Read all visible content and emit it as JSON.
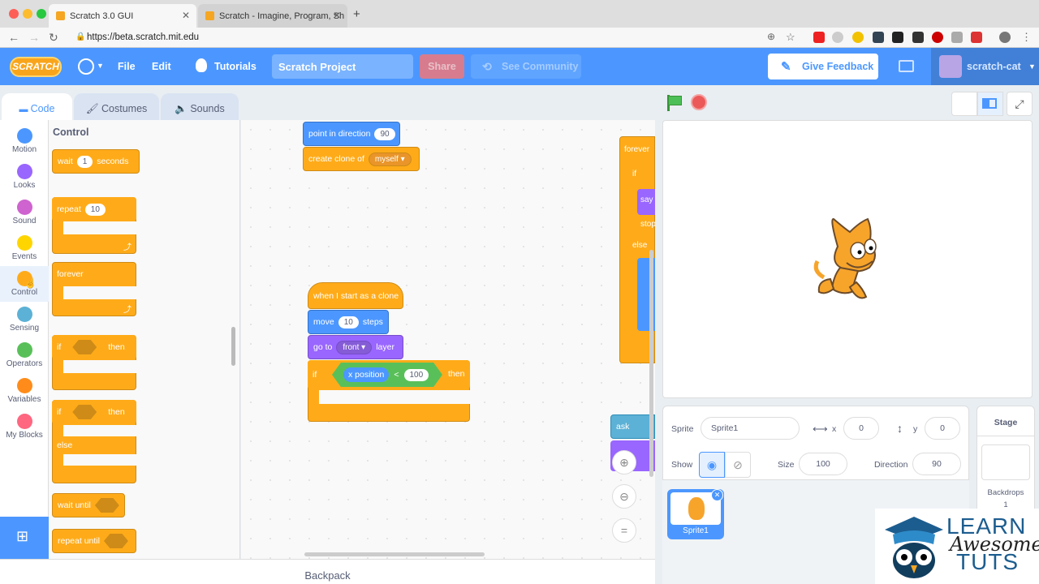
{
  "browser": {
    "tabs": [
      {
        "label": "Scratch 3.0 GUI"
      },
      {
        "label": "Scratch - Imagine, Program, Sh"
      }
    ],
    "url": "https://beta.scratch.mit.edu"
  },
  "menu": {
    "logo": "SCRATCH",
    "file": "File",
    "edit": "Edit",
    "tutorials": "Tutorials",
    "project_title": "Scratch Project",
    "share": "Share",
    "see_community": "See Community",
    "give_feedback": "Give Feedback",
    "username": "scratch-cat"
  },
  "editor_tabs": {
    "code": "Code",
    "costumes": "Costumes",
    "sounds": "Sounds"
  },
  "categories": [
    {
      "label": "Motion",
      "color": "#4c97ff"
    },
    {
      "label": "Looks",
      "color": "#9966ff"
    },
    {
      "label": "Sound",
      "color": "#cf63cf"
    },
    {
      "label": "Events",
      "color": "#ffd500"
    },
    {
      "label": "Control",
      "color": "#ffab19"
    },
    {
      "label": "Sensing",
      "color": "#5cb1d6"
    },
    {
      "label": "Operators",
      "color": "#59c059"
    },
    {
      "label": "Variables",
      "color": "#ff8c1a"
    },
    {
      "label": "My Blocks",
      "color": "#ff6680"
    }
  ],
  "palette": {
    "heading": "Control",
    "wait": {
      "a": "wait",
      "n": "1",
      "b": "seconds"
    },
    "repeat": {
      "a": "repeat",
      "n": "10"
    },
    "forever": "forever",
    "if_then": {
      "a": "if",
      "b": "then"
    },
    "if_else": {
      "a": "if",
      "b": "then",
      "c": "else"
    },
    "wait_until": "wait until",
    "repeat_until": "repeat until"
  },
  "workspace": {
    "point": {
      "a": "point in direction",
      "n": "90"
    },
    "clone": {
      "a": "create clone of",
      "d": "myself"
    },
    "hat": "when I start as a clone",
    "move": {
      "a": "move",
      "n": "10",
      "b": "steps"
    },
    "goto": {
      "a": "go to",
      "d": "front",
      "b": "layer"
    },
    "if": {
      "a": "if",
      "rep": "x position",
      "op": "<",
      "n": "100",
      "b": "then"
    },
    "side": {
      "forever": "forever",
      "if": "if",
      "say": "say",
      "stop": "stop",
      "else": "else",
      "ask": "ask"
    }
  },
  "backpack": "Backpack",
  "sprite_info": {
    "sprite_label": "Sprite",
    "sprite_name": "Sprite1",
    "x_label": "x",
    "x_value": "0",
    "y_label": "y",
    "y_value": "0",
    "show_label": "Show",
    "size_label": "Size",
    "size_value": "100",
    "direction_label": "Direction",
    "direction_value": "90"
  },
  "sprite_list": [
    {
      "name": "Sprite1"
    }
  ],
  "stage_panel": {
    "title": "Stage",
    "backdrops_label": "Backdrops",
    "backdrops_count": "1"
  },
  "watermark": {
    "line1": "LEARN",
    "line2": "Awesome",
    "line3": "TUTS"
  }
}
